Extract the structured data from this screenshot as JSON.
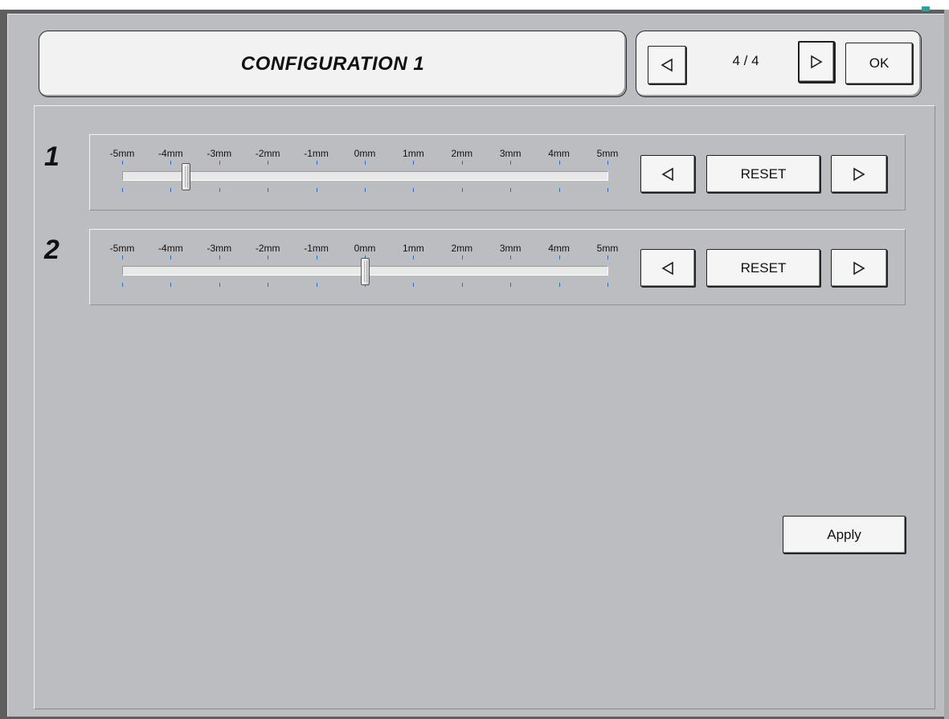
{
  "header": {
    "title": "CONFIGURATION 1",
    "page_indicator": "4 / 4",
    "ok_label": "OK"
  },
  "scale_labels": [
    "-5mm",
    "-4mm",
    "-3mm",
    "-2mm",
    "-1mm",
    "0mm",
    "1mm",
    "2mm",
    "3mm",
    "4mm",
    "5mm"
  ],
  "sliders": [
    {
      "number": "1",
      "value_mm": -3.7,
      "reset_label": "RESET"
    },
    {
      "number": "2",
      "value_mm": 0,
      "reset_label": "RESET"
    }
  ],
  "apply_label": "Apply",
  "colors": {
    "panel": "#bcbdc0",
    "tick": "#2b6cc2",
    "accent": "#2aa39a"
  },
  "icons": {
    "prev": "triangle-left-icon",
    "next": "triangle-right-icon"
  }
}
